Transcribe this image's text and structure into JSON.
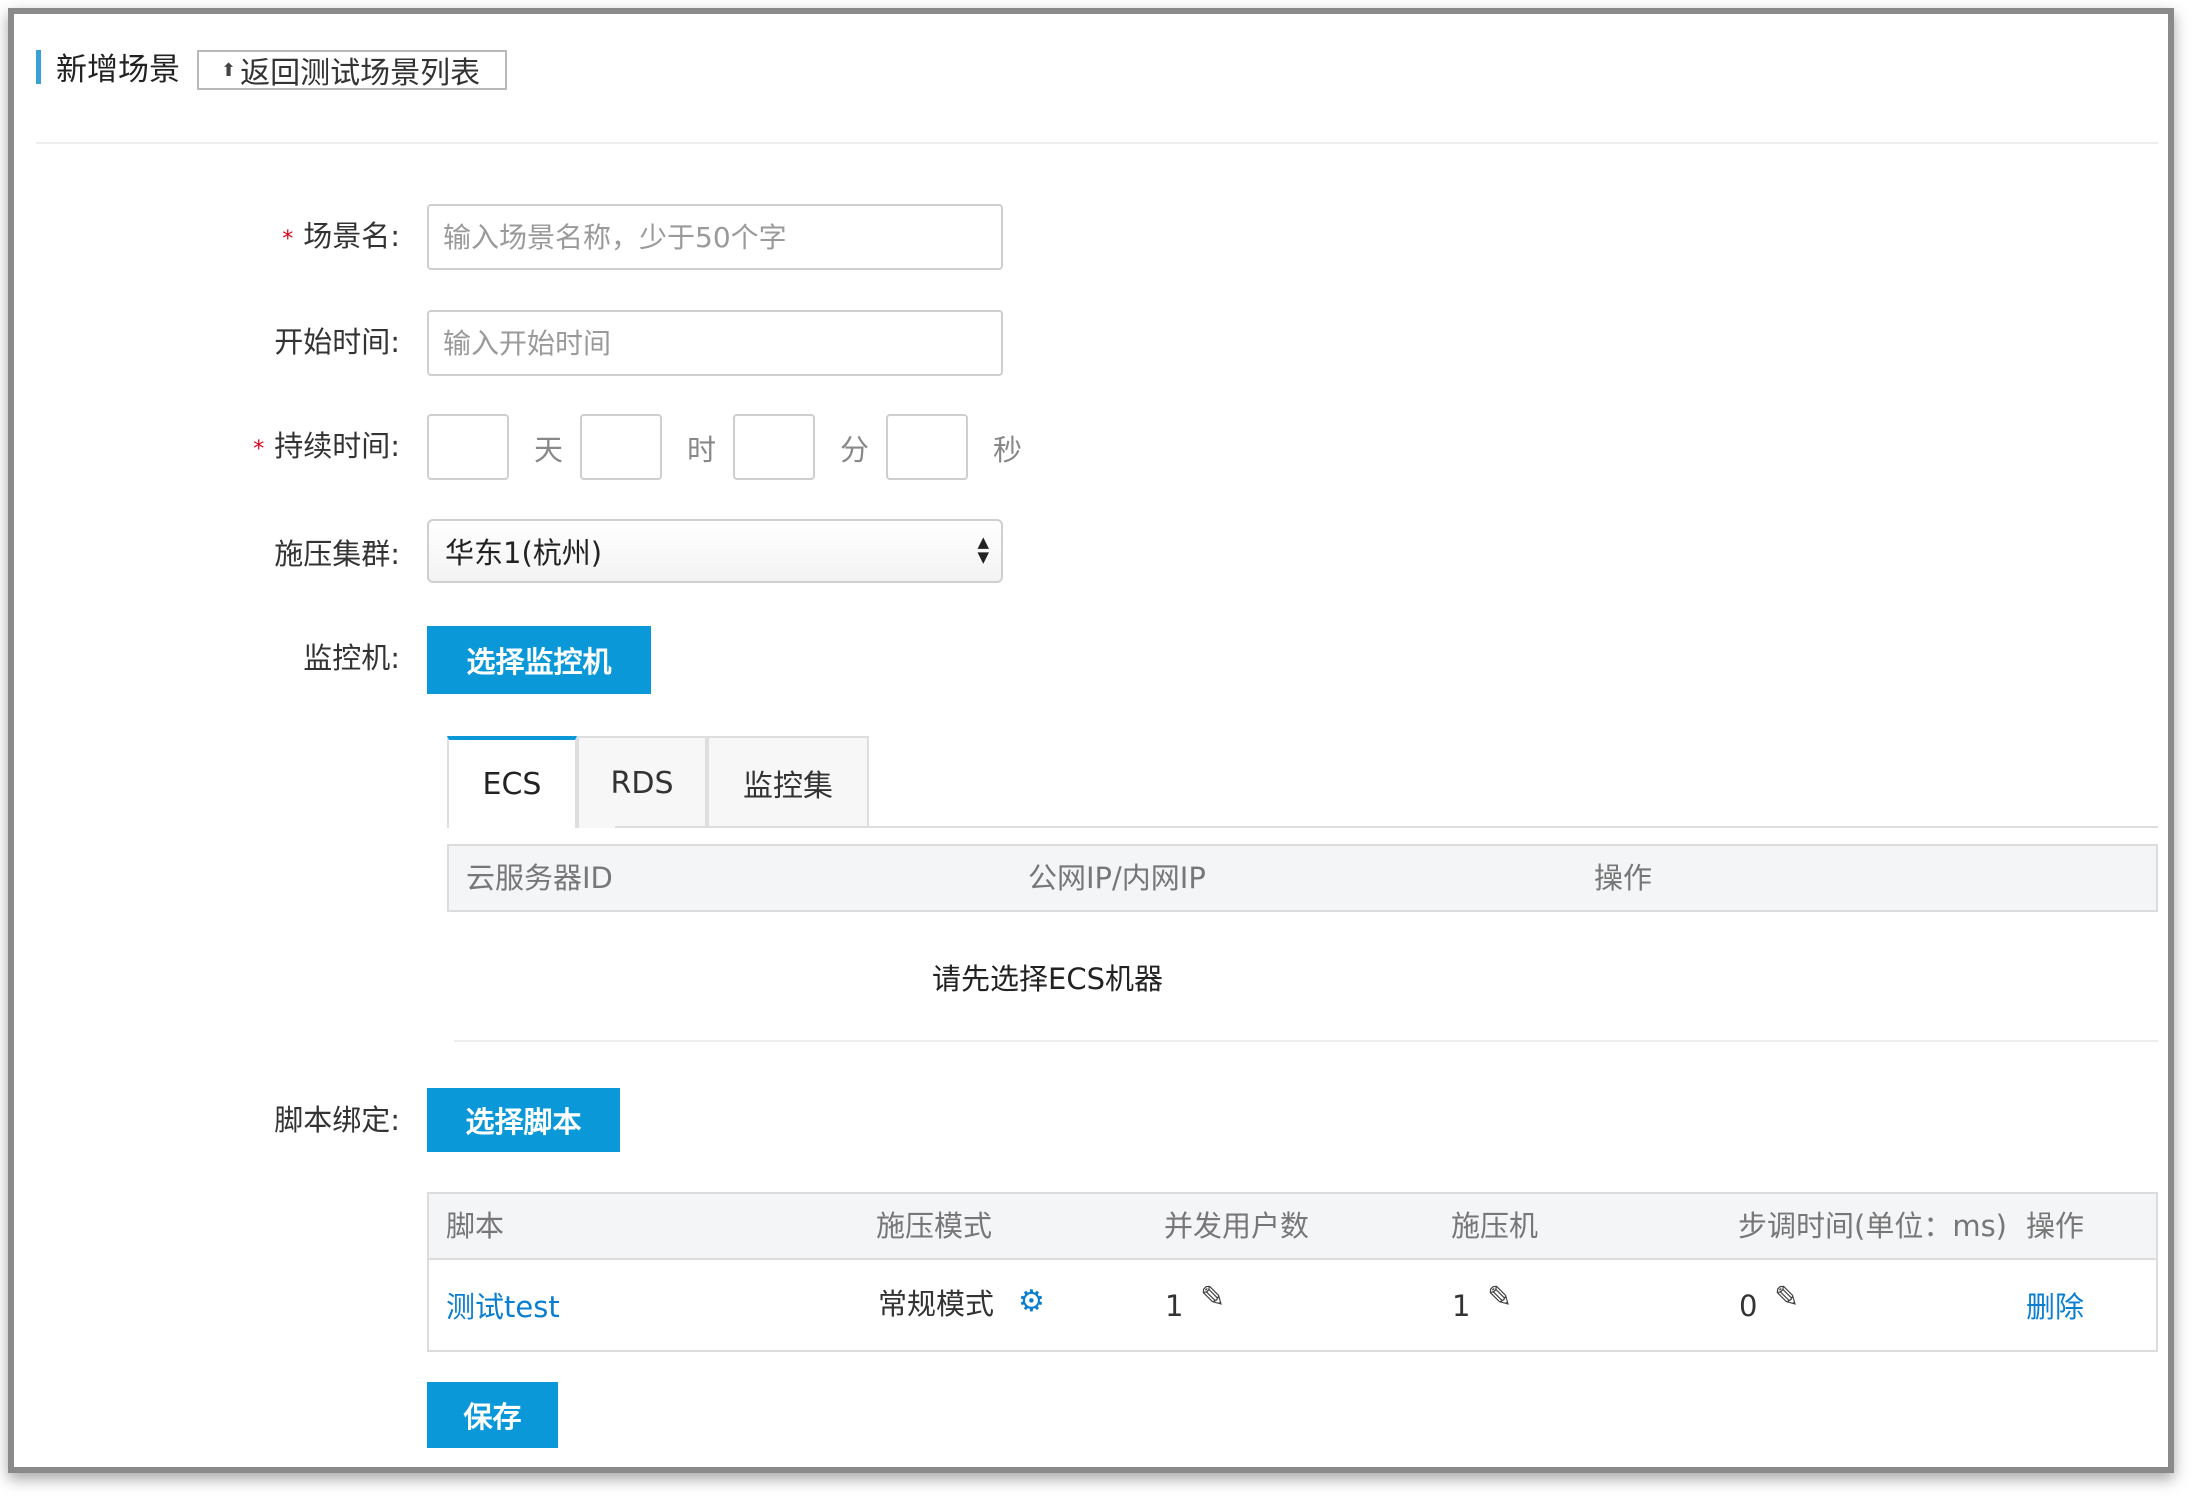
{
  "header": {
    "title": "新增场景",
    "back_label": "返回测试场景列表"
  },
  "form": {
    "scene_name": {
      "label": "场景名:",
      "placeholder": "输入场景名称，少于50个字",
      "required": true
    },
    "start_time": {
      "label": "开始时间:",
      "placeholder": "输入开始时间"
    },
    "duration": {
      "label": "持续时间:",
      "required": true,
      "units": [
        "天",
        "时",
        "分",
        "秒"
      ]
    },
    "cluster": {
      "label": "施压集群:",
      "value": "华东1(杭州)"
    },
    "monitor": {
      "label": "监控机:",
      "button": "选择监控机"
    },
    "script": {
      "label": "脚本绑定:",
      "button": "选择脚本"
    },
    "save": "保存"
  },
  "monitor_tabs": [
    {
      "label": "ECS",
      "active": true
    },
    {
      "label": "RDS",
      "active": false
    },
    {
      "label": "监控集",
      "active": false
    }
  ],
  "monitor_table": {
    "columns": [
      "云服务器ID",
      "公网IP/内网IP",
      "操作"
    ],
    "empty_text": "请先选择ECS机器"
  },
  "script_table": {
    "columns": [
      "脚本",
      "施压模式",
      "并发用户数",
      "施压机",
      "步调时间(单位：ms)",
      "操作"
    ],
    "rows": [
      {
        "script": "测试test",
        "mode": "常规模式",
        "users": "1",
        "machines": "1",
        "pacing": "0",
        "action": "删除"
      }
    ]
  },
  "colors": {
    "accent": "#0a98d8",
    "link": "#0a7fd1",
    "required": "#d9001b"
  }
}
